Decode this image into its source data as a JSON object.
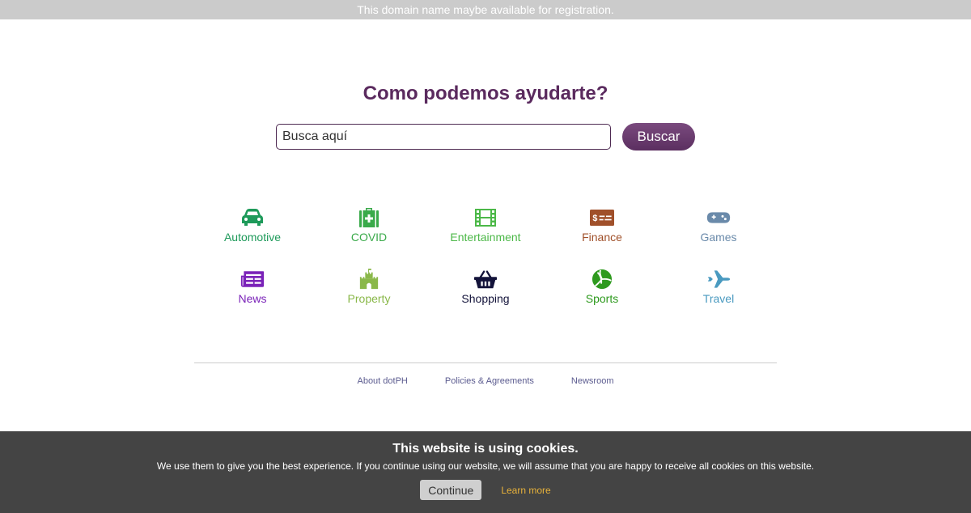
{
  "banner": {
    "text": "This domain name maybe available for registration."
  },
  "hero": {
    "title": "Como podemos ayudarte?",
    "search_placeholder": "Busca aquí",
    "search_value": "",
    "search_button": "Buscar"
  },
  "categories": [
    {
      "label": "Automotive",
      "icon": "car-icon",
      "color": "#1e9a5a"
    },
    {
      "label": "COVID",
      "icon": "medical-kit-icon",
      "color": "#3aaa4a"
    },
    {
      "label": "Entertainment",
      "icon": "film-icon",
      "color": "#4cb848"
    },
    {
      "label": "Finance",
      "icon": "money-bill-icon",
      "color": "#a0502a"
    },
    {
      "label": "Games",
      "icon": "gamepad-icon",
      "color": "#6a8aaa"
    },
    {
      "label": "News",
      "icon": "newspaper-icon",
      "color": "#7a22b8"
    },
    {
      "label": "Property",
      "icon": "castle-icon",
      "color": "#8ab84a"
    },
    {
      "label": "Shopping",
      "icon": "basket-icon",
      "color": "#13133a"
    },
    {
      "label": "Sports",
      "icon": "volleyball-icon",
      "color": "#2e9a1e"
    },
    {
      "label": "Travel",
      "icon": "plane-icon",
      "color": "#4a9ac0"
    }
  ],
  "footer": {
    "links": [
      "About dotPH",
      "Policies & Agreements",
      "Newsroom"
    ]
  },
  "cookie": {
    "title": "This website is using cookies.",
    "text": "We use them to give you the best experience. If you continue using our website, we will assume that you are happy to receive all cookies on this website.",
    "continue": "Continue",
    "learn_more": "Learn more"
  }
}
